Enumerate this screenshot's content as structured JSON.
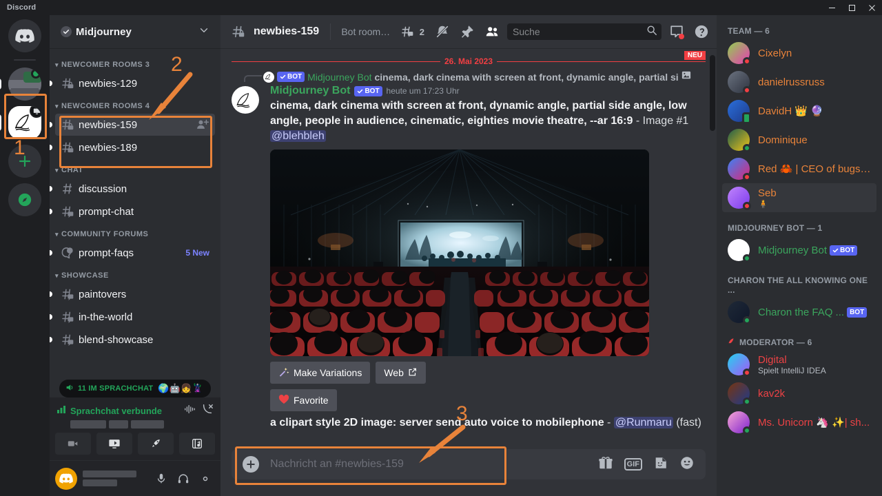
{
  "window": {
    "brand": "Discord",
    "controls": [
      "minimize",
      "maximize",
      "close"
    ]
  },
  "annotations": {
    "accent_color": "#e8833a",
    "markers": [
      {
        "label": "1",
        "target": "server-rail-midjourney-icon"
      },
      {
        "label": "2",
        "target": "newcomer-rooms-4-channels"
      },
      {
        "label": "3",
        "target": "message-composer"
      }
    ]
  },
  "server_rail": {
    "items": [
      {
        "name": "home",
        "icon": "discord-logo-icon"
      },
      {
        "name": "blurred-server",
        "icon": "server-avatar-icon"
      },
      {
        "name": "midjourney",
        "icon": "midjourney-sailboat-icon",
        "selected": true,
        "badge": "screenshare-icon"
      },
      {
        "name": "add-server",
        "icon": "plus-icon",
        "label": "+"
      },
      {
        "name": "explore-servers",
        "icon": "compass-icon"
      }
    ]
  },
  "sidebar": {
    "server_name": "Midjourney",
    "verified": true,
    "categories": [
      {
        "label": "NEWCOMER ROOMS 3",
        "channels": [
          {
            "name": "newbies-129",
            "icon": "thread-lock-icon",
            "unread": true,
            "active": false
          }
        ]
      },
      {
        "label": "NEWCOMER ROOMS 4",
        "channels": [
          {
            "name": "newbies-159",
            "icon": "thread-lock-icon",
            "unread": true,
            "active": true,
            "action": "add-member-icon"
          },
          {
            "name": "newbies-189",
            "icon": "thread-lock-icon",
            "unread": true,
            "active": false
          }
        ]
      },
      {
        "label": "CHAT",
        "channels": [
          {
            "name": "discussion",
            "icon": "hash-icon",
            "unread": true,
            "active": false
          },
          {
            "name": "prompt-chat",
            "icon": "thread-icon",
            "unread": true,
            "active": false
          }
        ]
      },
      {
        "label": "COMMUNITY FORUMS",
        "channels": [
          {
            "name": "prompt-faqs",
            "icon": "forum-icon",
            "unread": true,
            "active": false,
            "badge": "5 New"
          }
        ]
      },
      {
        "label": "SHOWCASE",
        "channels": [
          {
            "name": "paintovers",
            "icon": "thread-icon",
            "unread": true,
            "active": false
          },
          {
            "name": "in-the-world",
            "icon": "thread-icon",
            "unread": true,
            "active": false
          },
          {
            "name": "blend-showcase",
            "icon": "thread-icon",
            "unread": true,
            "active": false
          }
        ]
      }
    ],
    "voice_pill": {
      "label": "11 IM SPRACHCHAT",
      "faces": "🌍🤖👧🦹"
    },
    "voice_panel": {
      "status": "Sprachchat verbunde",
      "signal_icon": "signal-bars-icon",
      "soundboard_icon": "soundwave-icon",
      "disconnect_icon": "phone-hangup-icon",
      "buttons": [
        "video-icon",
        "screenshare-icon",
        "activity-rocket-icon",
        "soundboard-music-icon"
      ]
    },
    "user_panel": {
      "avatar_icon": "discord-logo-icon",
      "actions": [
        "microphone-icon",
        "headphones-icon",
        "settings-gear-icon"
      ]
    }
  },
  "chat_header": {
    "channel": "newbies-159",
    "channel_icon": "thread-lock-icon",
    "topic": "Bot room for new users. Type /imagine then describe what yo...",
    "thread_icon": "threads-icon",
    "thread_count": "2",
    "icons": [
      "notification-muted-icon",
      "pin-icon",
      "members-icon"
    ],
    "search": {
      "placeholder": "Suche",
      "value": "",
      "icon": "search-icon"
    },
    "inbox_icon": "inbox-icon",
    "inbox_has_unread": true,
    "help_icon": "help-icon"
  },
  "messages": {
    "date_divider": "26. Mai 2023",
    "new_badge": "NEU",
    "reply_reference": {
      "bot_tag": "BOT",
      "author": "Midjourney Bot",
      "text": "cinema, dark cinema with screen at front, dynamic angle, partial si",
      "attachment_icon": "image-icon"
    },
    "main": {
      "author": "Midjourney Bot",
      "bot_tag": "BOT",
      "timestamp": "heute um 17:23 Uhr",
      "prompt": "cinema, dark cinema with screen at front, dynamic angle, partial side angle, low angle, people in audience, cinematic, eighties movie theatre, --ar 16:9",
      "suffix": "- Image #1",
      "mention": "@blehbleh",
      "attachment_alt": "dark cinema interior with bright screen and audience",
      "buttons": [
        {
          "label": "Make Variations",
          "icon": "sparkle-wand-icon"
        },
        {
          "label": "Web",
          "icon": "external-link-icon"
        },
        {
          "label": "Favorite",
          "icon": "heart-icon"
        }
      ]
    },
    "next": {
      "prompt": "a clipart style 2D image: server send auto voice to mobilephone",
      "dash": "-",
      "mention": "@Runmaru",
      "suffix": "(fast)"
    }
  },
  "composer": {
    "placeholder": "Nachricht an #newbies-159",
    "value": "",
    "plus_icon": "plus-icon",
    "icons": [
      "gift-icon",
      "gif-icon",
      "sticker-icon",
      "emoji-icon"
    ],
    "gif_label": "GIF"
  },
  "members": {
    "groups": [
      {
        "label": "TEAM — 6",
        "people": [
          {
            "name": "Cixelyn",
            "color": "#e8833a",
            "status": "dnd",
            "avatar_colors": [
              "#8fd14f",
              "#e83ab4"
            ]
          },
          {
            "name": "danielrussruss",
            "color": "#e8833a",
            "status": "dnd",
            "avatar_colors": [
              "#6b7280",
              "#2e3440"
            ]
          },
          {
            "name": "DavidH 👑 🔮",
            "color": "#e8833a",
            "status": "mobile",
            "avatar_colors": [
              "#2a6fdb",
              "#1e3a8a"
            ]
          },
          {
            "name": "Dominique",
            "color": "#e8833a",
            "status": "online",
            "avatar_colors": [
              "#1f5c4a",
              "#f0c419"
            ]
          },
          {
            "name": "Red 🦀 | CEO of bugs ...",
            "color": "#e8833a",
            "status": "dnd",
            "avatar_colors": [
              "#3b82f6",
              "#db2777"
            ]
          },
          {
            "name": "Seb",
            "color": "#e8833a",
            "status": "dnd",
            "sub": "🧍",
            "hover": true,
            "avatar_colors": [
              "#c084fc",
              "#7c3aed"
            ]
          }
        ]
      },
      {
        "label": "MIDJOURNEY BOT — 1",
        "people": [
          {
            "name": "Midjourney Bot",
            "color": "#3ba55d",
            "status": "online",
            "tag": "BOT",
            "tag_check": true,
            "avatar_colors": [
              "#ffffff",
              "#ffffff"
            ]
          }
        ]
      },
      {
        "label": "CHARON THE ALL KNOWING ONE ...",
        "people": [
          {
            "name": "Charon the FAQ ...",
            "color": "#3ba55d",
            "status": "online",
            "tag": "BOT",
            "avatar_colors": [
              "#1f2937",
              "#0f172a"
            ]
          }
        ]
      },
      {
        "label": "MODERATOR — 6",
        "icon": "sailboat-role-icon",
        "people": [
          {
            "name": "Digital",
            "color": "#ed4245",
            "status": "dnd",
            "sub": "Spielt IntelliJ IDEA",
            "avatar_colors": [
              "#22d3ee",
              "#a855f7"
            ]
          },
          {
            "name": "kav2k",
            "color": "#ed4245",
            "status": "online",
            "avatar_colors": [
              "#78350f",
              "#1e3a8a"
            ]
          },
          {
            "name": "Ms. Unicorn 🦄 ✨| sh...",
            "color": "#ed4245",
            "status": "online",
            "avatar_colors": [
              "#f9a8d4",
              "#7e22ce"
            ]
          }
        ]
      }
    ]
  }
}
